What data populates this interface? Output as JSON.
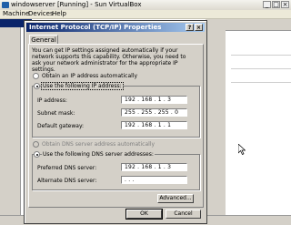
{
  "host": {
    "title": "windowserver [Running] - Sun VirtualBox",
    "menu": [
      "Machine",
      "Devices",
      "Help"
    ]
  },
  "dialog": {
    "title": "Internet Protocol (TCP/IP) Properties",
    "help_btn": "?",
    "close_btn": "×",
    "tab_general": "General",
    "description": "You can get IP settings assigned automatically if your network supports this capability. Otherwise, you need to ask your network administrator for the appropriate IP settings.",
    "radio_auto_ip": "Obtain an IP address automatically",
    "radio_manual_ip": "Use the following IP address:",
    "ip_address_label": "IP address:",
    "ip_address_value": "192 . 168 .  1  .  3",
    "subnet_label": "Subnet mask:",
    "subnet_value": "255 . 255 . 255 .  0",
    "gateway_label": "Default gateway:",
    "gateway_value": "192 . 168 .  1  .  1",
    "radio_auto_dns": "Obtain DNS server address automatically",
    "radio_manual_dns": "Use the following DNS server addresses:",
    "preferred_dns_label": "Preferred DNS server:",
    "preferred_dns_value": "192 . 168 .  1  .  3",
    "alternate_dns_label": "Alternate DNS server:",
    "alternate_dns_value": "  .    .    .",
    "advanced_btn": "Advanced...",
    "ok_btn": "OK",
    "cancel_btn": "Cancel"
  },
  "colors": {
    "title_active": "#0a246a",
    "face": "#d4d0c8"
  }
}
